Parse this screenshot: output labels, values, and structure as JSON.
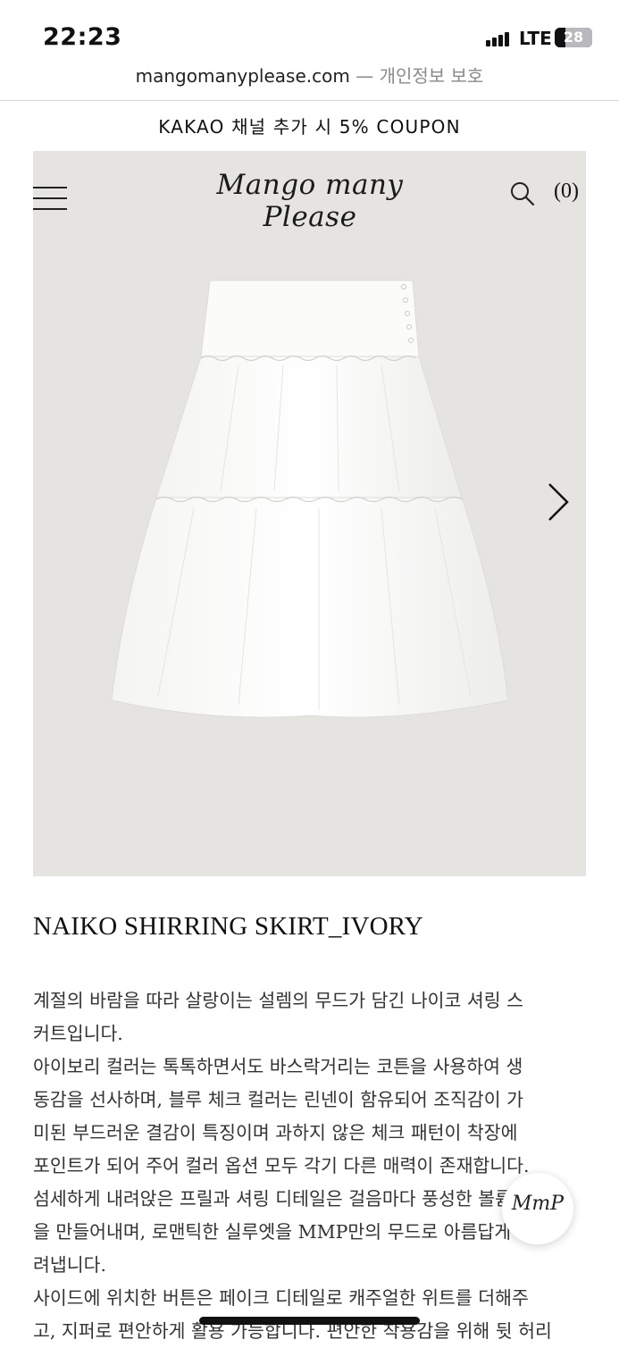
{
  "status_bar": {
    "time": "22:23",
    "network": "LTE",
    "battery": "28",
    "battery_level_percent": 28
  },
  "browser": {
    "domain": "mangomanyplease.com",
    "separator": " — ",
    "privacy": "개인정보 보호"
  },
  "announcement": "KAKAO 채널 추가 시 5% COUPON",
  "header": {
    "logo": "Mango many Please",
    "cart_count": "(0)",
    "icons": {
      "menu": "hamburger-icon",
      "search": "search-icon",
      "next": "chevron-right-icon"
    }
  },
  "product": {
    "title": "NAIKO SHIRRING SKIRT_IVORY",
    "description_lines": [
      "계절의 바람을 따라 살랑이는 설렘의 무드가 담긴 나이코 셔링 스",
      "커트입니다.",
      "아이보리 컬러는 톡톡하면서도 바스락거리는 코튼을 사용하여 생",
      "동감을 선사하며, 블루 체크 컬러는 린넨이 함유되어 조직감이 가",
      "미된 부드러운 결감이 특징이며 과하지 않은 체크 패턴이 착장에",
      "포인트가 되어 주어 컬러 옵션 모두 각기 다른 매력이 존재합니다.",
      "섬세하게 내려앉은 프릴과 셔링 디테일은 걸음마다 풍성한 볼륨감",
      "을 만들어내며, 로맨틱한 실루엣을 MMP만의 무드로 아름답게 그",
      "려냅니다.",
      "사이드에 위치한 버튼은 페이크 디테일로 캐주얼한 위트를 더해주",
      "고, 지퍼로 편안하게 활용 가능합니다. 편안한 착용감을 위해 뒷 허리"
    ]
  },
  "chat_button": {
    "label": "MmP"
  },
  "colors": {
    "hero_bg": "#e6e4e1",
    "text": "#333333",
    "accent": "#111111"
  }
}
